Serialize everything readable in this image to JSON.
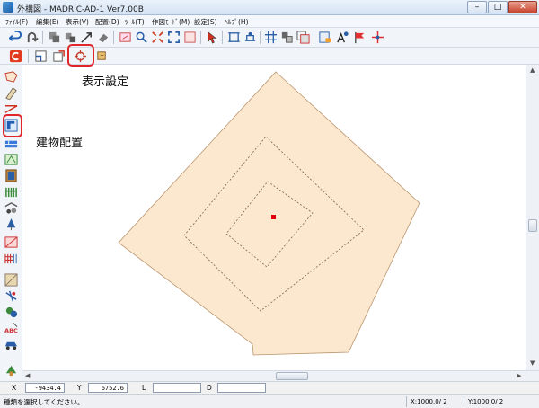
{
  "window": {
    "title": "外構図 - MADRIC-AD-1 Ver7.00B",
    "min": "–",
    "max": "□",
    "close": "✕"
  },
  "menu": [
    {
      "label": "ﾌｧｲﾙ(F)"
    },
    {
      "label": "編集(E)"
    },
    {
      "label": "表示(V)"
    },
    {
      "label": "配置(D)"
    },
    {
      "label": "ﾂｰﾙ(T)"
    },
    {
      "label": "作図ﾓｰﾄﾞ(M)"
    },
    {
      "label": "設定(S)"
    },
    {
      "label": "ﾍﾙﾌﾟ(H)"
    }
  ],
  "annotations": {
    "display_settings": "表示設定",
    "building_placement": "建物配置"
  },
  "coords": {
    "x_label": "X",
    "x_value": "-9434.4",
    "y_label": "Y",
    "y_value": "6752.6",
    "l_label": "L",
    "l_value": "",
    "d_label": "D",
    "d_value": ""
  },
  "status": {
    "message": "種類を選択してください。",
    "scale_x": "X:1000.0/ 2",
    "scale_y": "Y:1000.0/ 2"
  },
  "colors": {
    "lot_fill": "#fce8cf",
    "lot_stroke": "#b9966f",
    "offset_line": "#7a6650",
    "marker": "#e0000a",
    "highlight": "#e0262a"
  },
  "icons": {
    "toolbar1": [
      "undo-icon",
      "redo-icon",
      "copy-icon",
      "paste-icon",
      "arrow-line-icon",
      "eraser-icon",
      "redraw-icon",
      "zoom-icon",
      "zoom-fit-icon",
      "zoom-area-icon",
      "window-icon",
      "select-pointer-icon",
      "dimension-icon",
      "measure-icon",
      "grid-move-icon",
      "layer-icon",
      "layer-2-icon",
      "print-preview-icon",
      "text-style-icon",
      "flag-icon",
      "cross-marker-icon"
    ],
    "toolbar2": [
      "cancel-icon",
      "save-icon",
      "export-icon",
      "display-settings-icon",
      "settings-icon"
    ],
    "leftbar": [
      "terrain-icon",
      "edit-shape-icon",
      "ruler-icon",
      "building-placement-icon",
      "block-wall-icon",
      "gate-icon",
      "door-icon",
      "fence-icon",
      "carport-icon",
      "tree-icon",
      "water-icon",
      "road-icon",
      "stair-icon",
      "paving-icon",
      "light-icon",
      "plant-icon",
      "text-abc-icon",
      "car-icon",
      "misc-icon"
    ]
  }
}
